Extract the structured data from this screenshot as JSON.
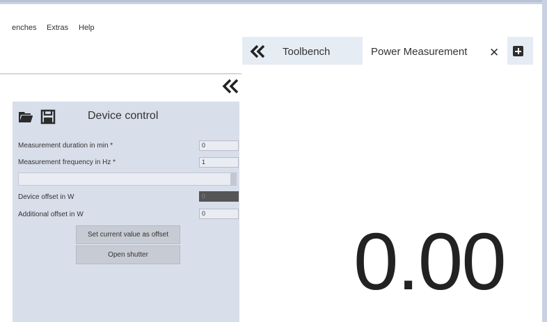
{
  "menubar": {
    "items": [
      {
        "label": "enches"
      },
      {
        "label": "Extras"
      },
      {
        "label": "Help"
      }
    ]
  },
  "device_control": {
    "title": "Device control",
    "fields": {
      "duration": {
        "label": "Measurement duration in min *",
        "value": "0"
      },
      "frequency": {
        "label": "Measurement frequency in Hz *",
        "value": "1"
      },
      "device_offset": {
        "label": "Device offset in W",
        "value": "0"
      },
      "additional_offset": {
        "label": "Additional offset in W",
        "value": "0"
      }
    },
    "buttons": {
      "set_offset": "Set current value as offset",
      "open_shutter": "Open shutter"
    }
  },
  "tabs": {
    "toolbench": "Toolbench",
    "power_measurement": "Power Measurement",
    "close_glyph": "✕"
  },
  "display": {
    "value": "0.00"
  },
  "icons": {
    "left_collapse": "chevrons-left-icon",
    "tab_collapse": "chevrons-left-icon",
    "open": "folder-icon",
    "save": "save-icon",
    "add_tab": "plus-square-icon",
    "close_tab": "close-icon"
  },
  "colors": {
    "panel_bg": "#d8deea",
    "tabstrip_bg": "#e6ecf4",
    "button_bg": "#c7cbd3",
    "dark_field": "#555555"
  }
}
